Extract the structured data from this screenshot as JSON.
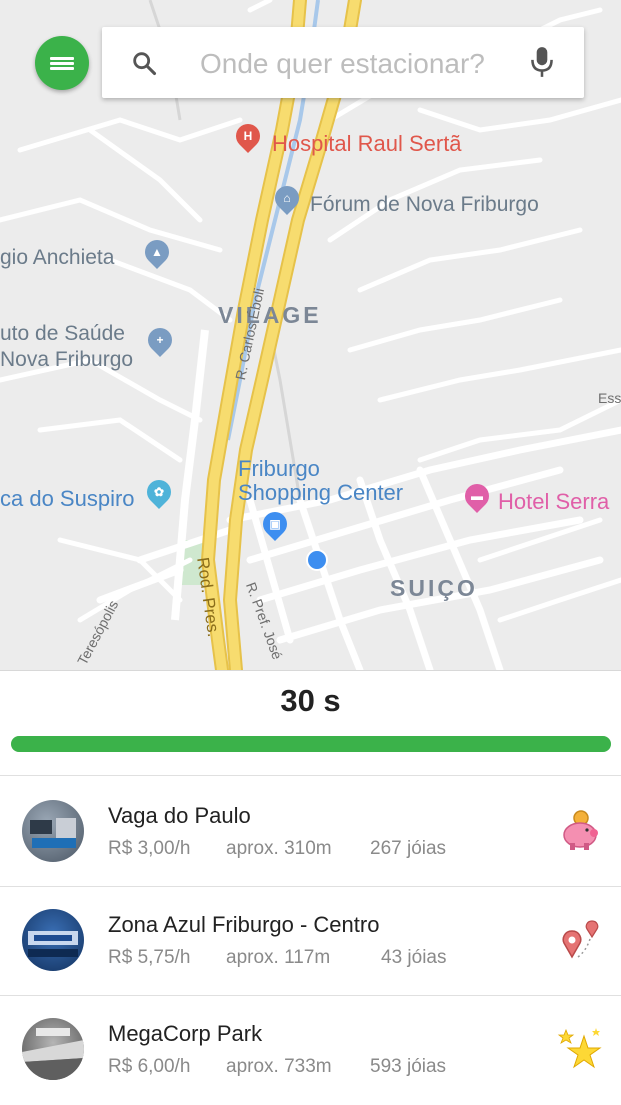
{
  "search": {
    "placeholder": "Onde quer estacionar?"
  },
  "map": {
    "labels": {
      "hospital": "Hospital Raul Sertã",
      "forum": "Fórum de Nova Friburgo",
      "anchieta": "gio Anchieta",
      "saude_1": "uto de Saúde",
      "saude_2": "Nova Friburgo",
      "vilage": "VILAGE",
      "suspiro": "ca do Suspiro",
      "shopping_1": "Friburgo",
      "shopping_2": "Shopping Center",
      "hotel": "Hotel Serra",
      "suico": "SUIÇO",
      "street_carlos": "R. Carlos Éboli",
      "street_rod": "Rod. Pres. ",
      "street_pref": "R. Pref. José ",
      "street_teres": "Teresópolis",
      "street_ess": "Ess"
    }
  },
  "timer": {
    "label": "30 s",
    "progress": 1.0
  },
  "parking_list": [
    {
      "name": "Vaga do Paulo",
      "price": "R$ 3,00/h",
      "distance": "aprox. 310m",
      "jewels": "267 jóias",
      "badge_icon": "piggy-bank-icon"
    },
    {
      "name": "Zona Azul Friburgo - Centro",
      "price": "R$ 5,75/h",
      "distance": "aprox. 117m",
      "jewels": "43 jóias",
      "badge_icon": "location-pins-icon"
    },
    {
      "name": "MegaCorp Park",
      "price": "R$ 6,00/h",
      "distance": "aprox. 733m",
      "jewels": "593 jóias",
      "badge_icon": "stars-icon"
    }
  ],
  "colors": {
    "accent_green": "#3bb24a",
    "map_bg": "#ececec",
    "highway_yellow": "#f7dc6f"
  }
}
